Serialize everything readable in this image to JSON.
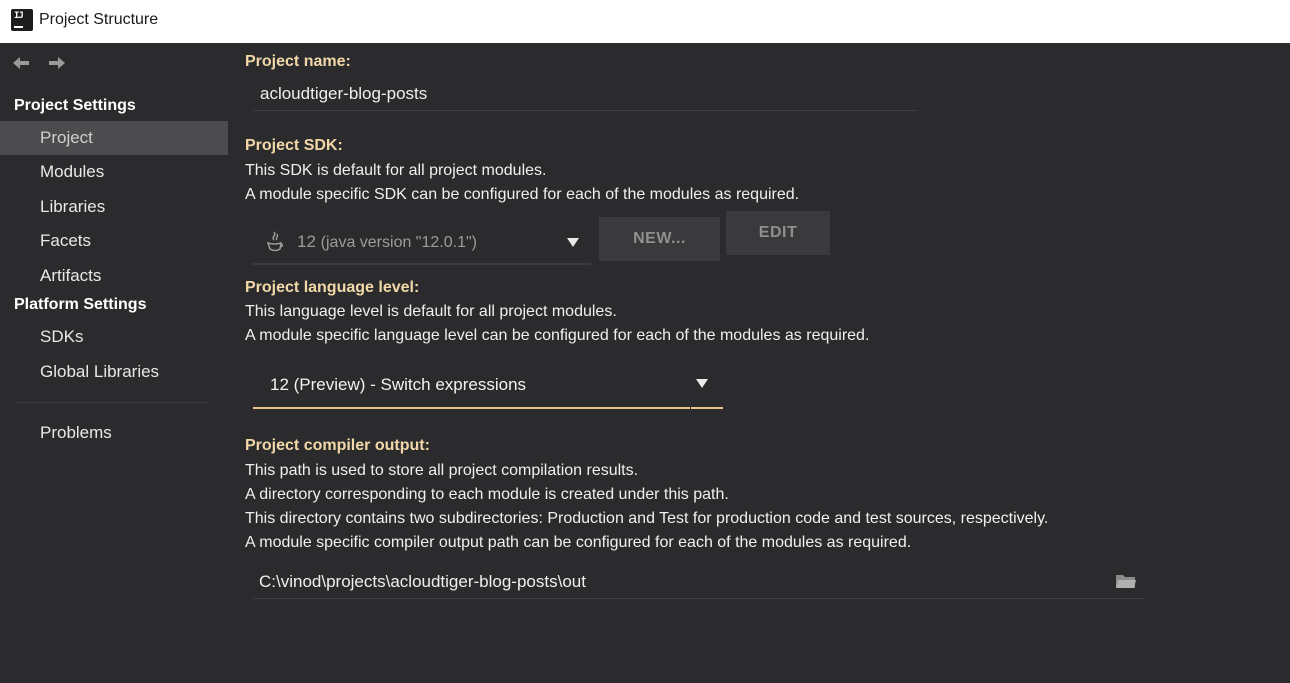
{
  "window": {
    "title": "Project Structure",
    "app_icon": "intellij-icon"
  },
  "sidebar": {
    "nav_back_icon": "back-arrow-icon",
    "nav_forward_icon": "forward-arrow-icon",
    "project_settings_title": "Project Settings",
    "project_items": [
      {
        "label": "Project",
        "selected": true
      },
      {
        "label": "Modules",
        "selected": false
      },
      {
        "label": "Libraries",
        "selected": false
      },
      {
        "label": "Facets",
        "selected": false
      },
      {
        "label": "Artifacts",
        "selected": false
      }
    ],
    "platform_settings_title": "Platform Settings",
    "platform_items": [
      {
        "label": "SDKs"
      },
      {
        "label": "Global Libraries"
      }
    ],
    "problems_label": "Problems"
  },
  "main": {
    "project_name": {
      "label": "Project name:",
      "value": "acloudtiger-blog-posts"
    },
    "project_sdk": {
      "label": "Project SDK:",
      "desc1": "This SDK is default for all project modules.",
      "desc2": "A module specific SDK can be configured for each of the modules as required.",
      "selected_version": "12",
      "selected_detail": "(java version \"12.0.1\")",
      "icon": "java-icon",
      "new_button": "NEW...",
      "edit_button": "EDIT"
    },
    "language_level": {
      "label": "Project language level:",
      "desc1": "This language level is default for all project modules.",
      "desc2": "A module specific language level can be configured for each of the modules as required.",
      "selected": "12 (Preview) - Switch expressions"
    },
    "compiler_output": {
      "label": "Project compiler output:",
      "desc1": "This path is used to store all project compilation results.",
      "desc2": "A directory corresponding to each module is created under this path.",
      "desc3": "This directory contains two subdirectories: Production and Test for production code and test sources, respectively.",
      "desc4": "A module specific compiler output path can be configured for each of the modules as required.",
      "path": "C:\\vinod\\projects\\acloudtiger-blog-posts\\out",
      "browse_icon": "folder-icon"
    }
  },
  "colors": {
    "background": "#2b2b2d",
    "label_accent": "#f2d8a8",
    "selected_item_bg": "#4c4c4f",
    "focus_underline": "#e8c58a"
  }
}
